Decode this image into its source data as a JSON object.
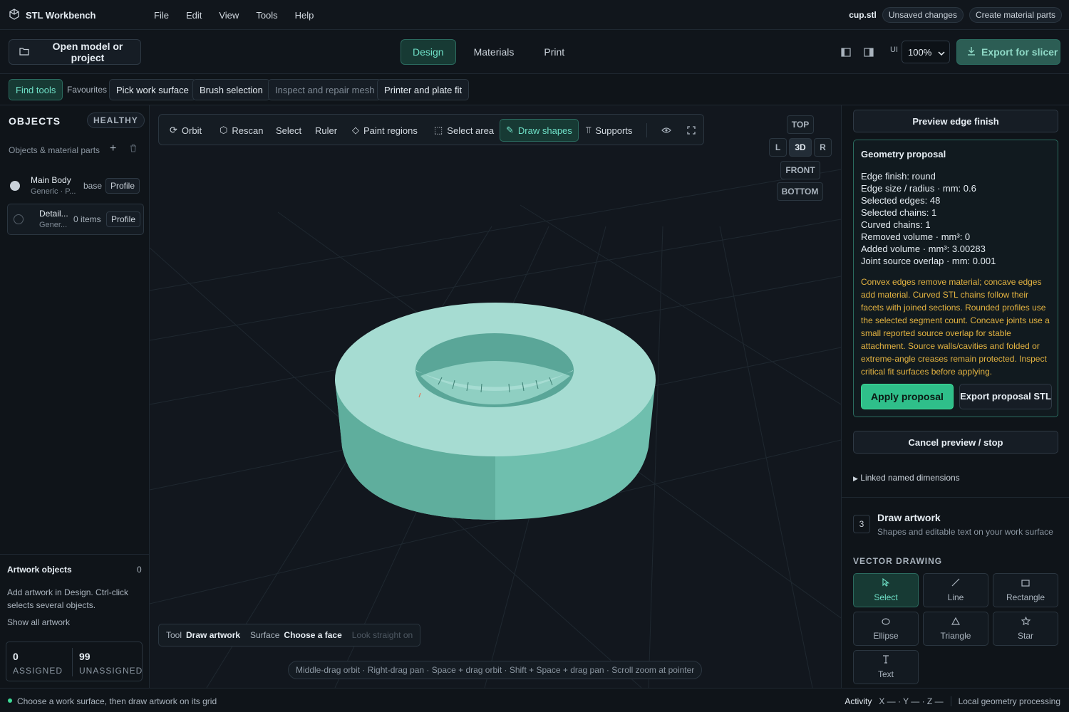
{
  "app": {
    "name": "STL Workbench"
  },
  "menu": [
    "File",
    "Edit",
    "View",
    "Tools",
    "Help"
  ],
  "file": {
    "name": "cup.stl",
    "status_chip": "Unsaved changes",
    "action_chip": "Create material parts"
  },
  "toolbar": {
    "open_label": "Open model or project",
    "modes": [
      "Design",
      "Materials",
      "Print"
    ],
    "active_mode": "Design",
    "ui_label": "UI",
    "zoom": "100%",
    "export_label": "Export for slicer"
  },
  "tools": {
    "find": "Find tools",
    "favourites": "Favourites",
    "items": [
      "Pick work surface",
      "Brush selection",
      "Inspect and repair mesh",
      "Printer and plate fit"
    ]
  },
  "objects": {
    "title": "OBJECTS",
    "health": "HEALTHY",
    "subtitle": "Objects & material parts",
    "rows": [
      {
        "name": "Main Body",
        "sub": "Generic · P...",
        "tag": "base",
        "profile": "Profile",
        "color": "#c9d1d9"
      },
      {
        "name": "Detail...",
        "sub": "Gener...",
        "tag": "0 items",
        "profile": "Profile",
        "color": "transparent"
      }
    ]
  },
  "artwork": {
    "title": "Artwork objects",
    "count": "0",
    "help": "Add artwork in Design. Ctrl-click selects several objects.",
    "show_all": "Show all artwork",
    "assigned": "0",
    "assigned_label": "ASSIGNED",
    "unassigned": "99",
    "unassigned_label": "UNASSIGNED"
  },
  "viewport_tools": [
    "Orbit",
    "Rescan",
    "Select",
    "Ruler",
    "Paint regions",
    "Select area",
    "Draw shapes",
    "Supports"
  ],
  "active_viewport_tool": "Draw shapes",
  "view_cube": {
    "top": "TOP",
    "left": "L",
    "center": "3D",
    "right": "R",
    "front": "FRONT",
    "bottom": "BOTTOM"
  },
  "status": {
    "tool_label": "Tool",
    "tool": "Draw artwork",
    "surface_label": "Surface",
    "surface": "Choose a face",
    "look": "Look straight on"
  },
  "hint": "Middle-drag orbit · Right-drag pan · Space + drag orbit · Shift + Space + drag pan · Scroll zoom at pointer",
  "right": {
    "preview_btn": "Preview edge finish",
    "proposal_title": "Geometry proposal",
    "stats": [
      "Edge finish: round",
      "Edge size / radius · mm: 0.6",
      "Selected edges: 48",
      "Selected chains: 1",
      "Curved chains: 1",
      "Removed volume · mm³: 0",
      "Added volume · mm³: 3.00283",
      "Joint source overlap · mm: 0.001"
    ],
    "note": "Convex edges remove material; concave edges add material. Curved STL chains follow their facets with joined sections. Rounded profiles use the selected segment count. Concave joints use a small reported source overlap for stable attachment. Source walls/cavities and folded or extreme-angle creases remain protected. Inspect critical fit surfaces before applying.",
    "apply": "Apply proposal",
    "export_proposal": "Export proposal STL",
    "cancel": "Cancel preview / stop",
    "linked": "Linked named dimensions",
    "step": "3",
    "draw_title": "Draw artwork",
    "draw_sub": "Shapes and editable text on your work surface",
    "vector_title": "VECTOR DRAWING",
    "vector_tools": [
      "Select",
      "Line",
      "Rectangle",
      "Ellipse",
      "Triangle",
      "Star",
      "Text"
    ],
    "active_vector_tool": "Select"
  },
  "footer": {
    "message": "Choose a work surface, then draw artwork on its grid",
    "activity": "Activity",
    "coords": "X — · Y — · Z —",
    "processing": "Local geometry processing"
  },
  "colors": {
    "accent": "#6fe0c7",
    "model": "#9fdcd0",
    "warning": "#e3b341",
    "apply": "#2fbf8a"
  }
}
